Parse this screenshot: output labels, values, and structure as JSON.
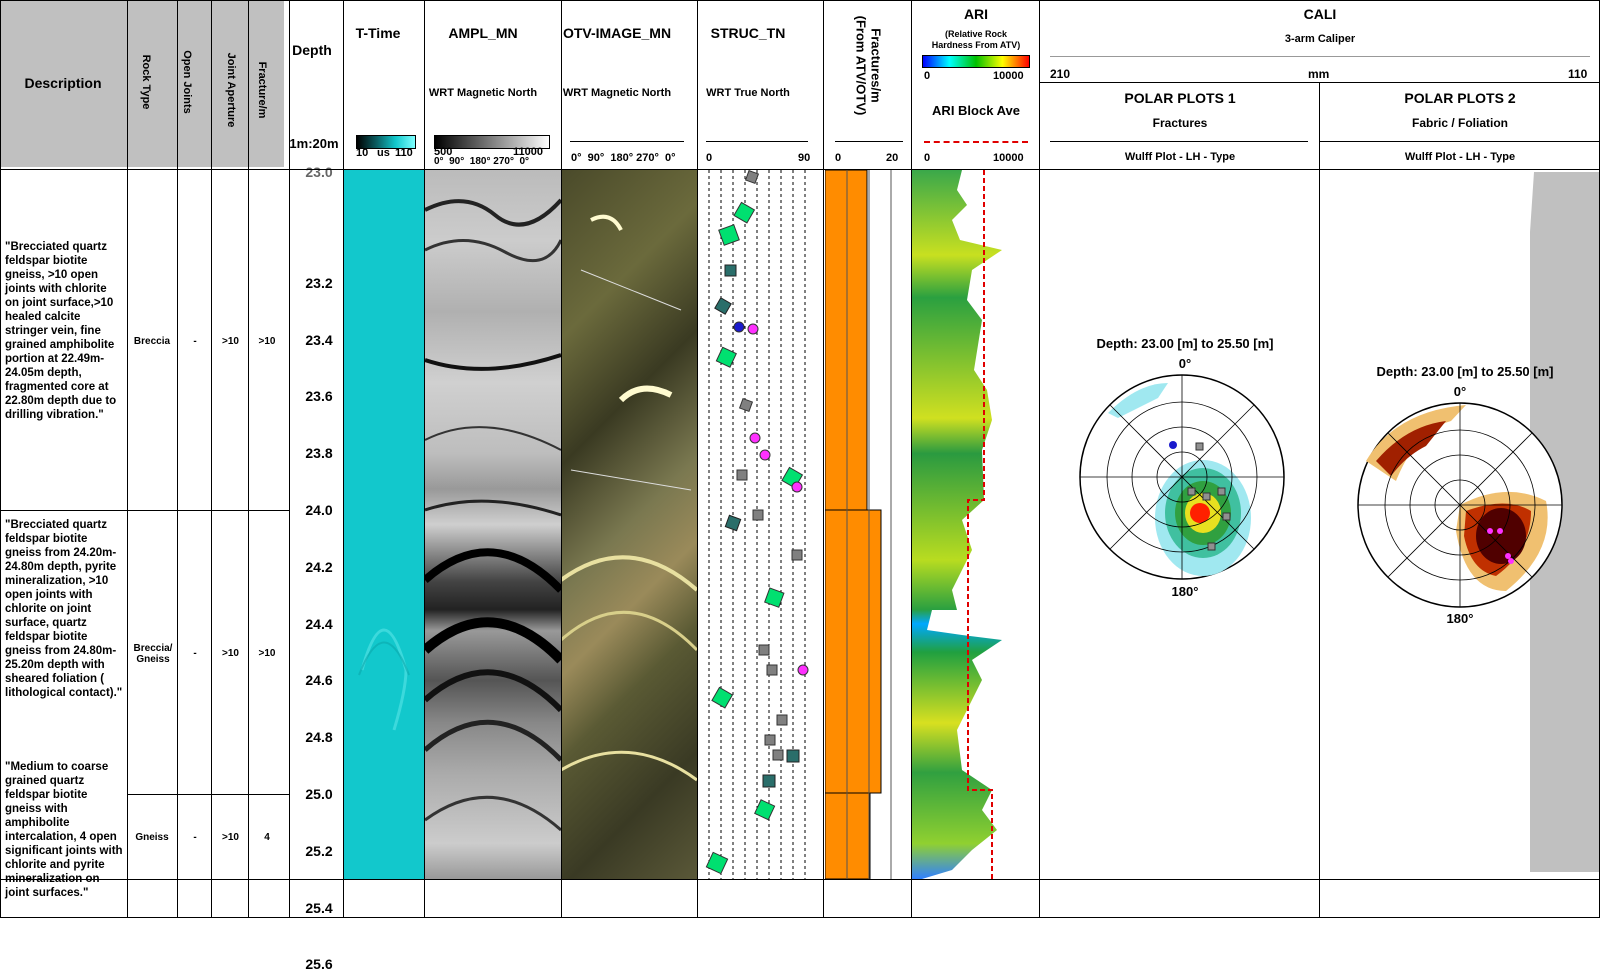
{
  "headers": {
    "description": "Description",
    "rock_type": "Rock Type",
    "open_joints": "Open Joints",
    "joint_aperture": "Joint Aperture",
    "fracture_m": "Fracture/m",
    "depth": "Depth",
    "depth_scale": "1m:20m",
    "ttime": {
      "title": "T-Time",
      "scale_min": "10",
      "scale_unit": "us",
      "scale_max": "110"
    },
    "ampl": {
      "title": "AMPL_MN",
      "sub": "WRT Magnetic North",
      "scale_min": "500",
      "scale_max": "11000",
      "azimuths": "0°  90°  180° 270°  0°"
    },
    "otv": {
      "title": "OTV-IMAGE_MN",
      "sub": "WRT Magnetic North",
      "azimuths": "0°  90°  180° 270°  0°"
    },
    "struc": {
      "title": "STRUC_TN",
      "sub": "WRT True North",
      "min": "0",
      "max": "90"
    },
    "fractures": {
      "title": "Fractures/m",
      "sub": "(From ATV/OTV)",
      "min": "0",
      "max": "20"
    },
    "ari": {
      "title": "ARI",
      "sub1": "(Relative Rock",
      "sub2": "Hardness From ATV)",
      "min": "0",
      "max": "10000",
      "block": "ARI Block Ave",
      "min2": "0",
      "max2": "10000"
    },
    "cali": {
      "title": "CALI",
      "sub": "3-arm Caliper",
      "left": "210",
      "unit": "mm",
      "right": "110"
    },
    "polar1": {
      "title": "POLAR PLOTS 1",
      "sub": "Fractures",
      "plot": "Wulff Plot - LH - Type"
    },
    "polar2": {
      "title": "POLAR PLOTS 2",
      "sub": "Fabric / Foliation",
      "plot": "Wulff Plot - LH - Type"
    }
  },
  "depth_ticks": [
    "23.0",
    "23.2",
    "23.4",
    "23.6",
    "23.8",
    "24.0",
    "24.2",
    "24.4",
    "24.6",
    "24.8",
    "25.0",
    "25.2",
    "25.4",
    "25.6"
  ],
  "intervals": [
    {
      "description": "\"Brecciated quartz feldspar biotite gneiss, >10 open joints with chlorite on joint surface,>10 healed calcite stringer vein, fine grained amphibolite portion at 22.49m-24.05m depth, fragmented core at 22.80m depth due to drilling vibration.\"",
      "rock_type": "Breccia",
      "open_joints": "-",
      "joint_aperture": ">10",
      "fracture_m": ">10"
    },
    {
      "description": "\"Brecciated quartz feldspar biotite gneiss from 24.20m-24.80m depth, pyrite mineralization,  >10 open joints with chlorite on joint surface, quartz feldspar biotite gneiss from 24.80m-25.20m depth with sheared foliation ( lithological contact).\"",
      "rock_type": "Breccia/ Gneiss",
      "open_joints": "-",
      "joint_aperture": ">10",
      "fracture_m": ">10"
    },
    {
      "description": "\"Medium to coarse grained quartz feldspar biotite gneiss with amphibolite intercalation, 4 open significant joints with chlorite and pyrite mineralization on joint surfaces.\"",
      "rock_type": "Gneiss",
      "open_joints": "-",
      "joint_aperture": ">10",
      "fracture_m": "4"
    }
  ],
  "polar_plots": [
    {
      "label": "Depth: 23.00 [m] to 25.50 [m]",
      "north": "0°",
      "south": "180°"
    },
    {
      "label": "Depth: 23.00 [m] to 25.50 [m]",
      "north": "0°",
      "south": "180°"
    }
  ],
  "colors": {
    "header_gray": "#c0c0c0",
    "ttime": "#12c8cc",
    "fracture_bar": "#ff8c00",
    "ari_block": "#e00000"
  }
}
